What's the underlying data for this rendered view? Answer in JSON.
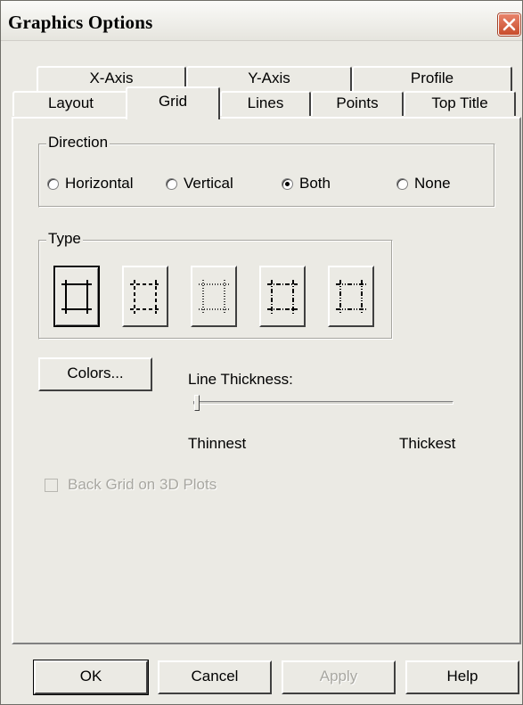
{
  "window": {
    "title": "Graphics Options"
  },
  "tabs": {
    "row1": [
      {
        "label": "X-Axis"
      },
      {
        "label": "Y-Axis"
      },
      {
        "label": "Profile"
      }
    ],
    "row2": [
      {
        "label": "Layout"
      },
      {
        "label": "Grid",
        "active": true
      },
      {
        "label": "Lines"
      },
      {
        "label": "Points"
      },
      {
        "label": "Top Title"
      }
    ]
  },
  "direction": {
    "label": "Direction",
    "options": [
      "Horizontal",
      "Vertical",
      "Both",
      "None"
    ],
    "selected": "Both"
  },
  "type": {
    "label": "Type",
    "options": [
      "solid-grid-icon",
      "dashed-grid-icon",
      "dotted-grid-icon",
      "dash-dot-grid-icon",
      "dash-dot-dot-grid-icon"
    ],
    "selected_index": 0
  },
  "colors_button": {
    "label": "Colors..."
  },
  "line_thickness": {
    "label": "Line Thickness:",
    "min_label": "Thinnest",
    "max_label": "Thickest",
    "value": 0
  },
  "back_grid": {
    "label": "Back Grid on 3D Plots",
    "checked": false,
    "enabled": false
  },
  "buttons": {
    "ok": "OK",
    "cancel": "Cancel",
    "apply": "Apply",
    "help": "Help"
  },
  "colors": {
    "dialog_bg": "#ebeae4",
    "close_button": "#c84d2c"
  }
}
